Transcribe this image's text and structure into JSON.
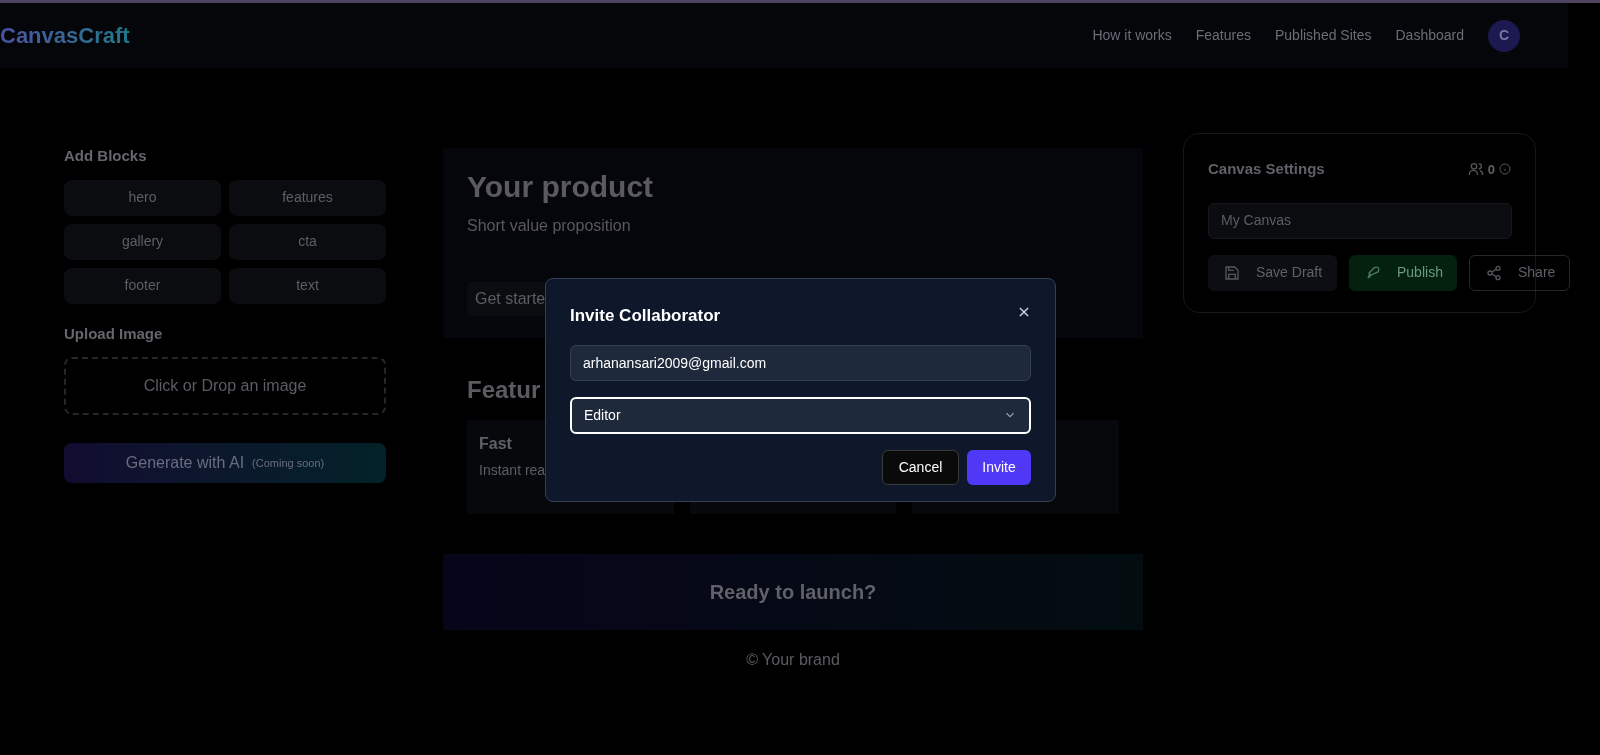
{
  "header": {
    "logo": "CanvasCraft",
    "nav": [
      "How it works",
      "Features",
      "Published Sites",
      "Dashboard"
    ],
    "avatar": "C"
  },
  "add_blocks": {
    "title": "Add Blocks",
    "blocks": [
      "hero",
      "features",
      "gallery",
      "cta",
      "footer",
      "text"
    ]
  },
  "upload": {
    "title": "Upload Image",
    "dropzone": "Click or Drop an image"
  },
  "generate_button": {
    "label": "Generate with AI",
    "note": "(Coming soon)"
  },
  "canvas": {
    "hero": {
      "title": "Your product",
      "subtitle": "Short value proposition",
      "button": "Get starte"
    },
    "features": {
      "heading": "Featur",
      "cards": [
        {
          "kind": "text",
          "title": "Fast",
          "text": "Instant rea"
        },
        {
          "kind": "empty"
        },
        {
          "kind": "empty"
        }
      ]
    },
    "cta": {
      "title": "Ready to launch?"
    },
    "footer": "© Your brand"
  },
  "settings": {
    "title": "Canvas Settings",
    "collaborators": "0",
    "name_value": "My Canvas",
    "buttons": [
      {
        "kind": "save",
        "label": "Save Draft"
      },
      {
        "kind": "publish",
        "label": "Publish"
      },
      {
        "kind": "share",
        "label": "Share"
      }
    ]
  },
  "modal": {
    "title": "Invite Collaborator",
    "email_value": "arhanansari2009@gmail.com",
    "role": "Editor",
    "buttons": [
      {
        "kind": "cancel",
        "label": "Cancel"
      },
      {
        "kind": "invite",
        "label": "Invite"
      }
    ]
  }
}
